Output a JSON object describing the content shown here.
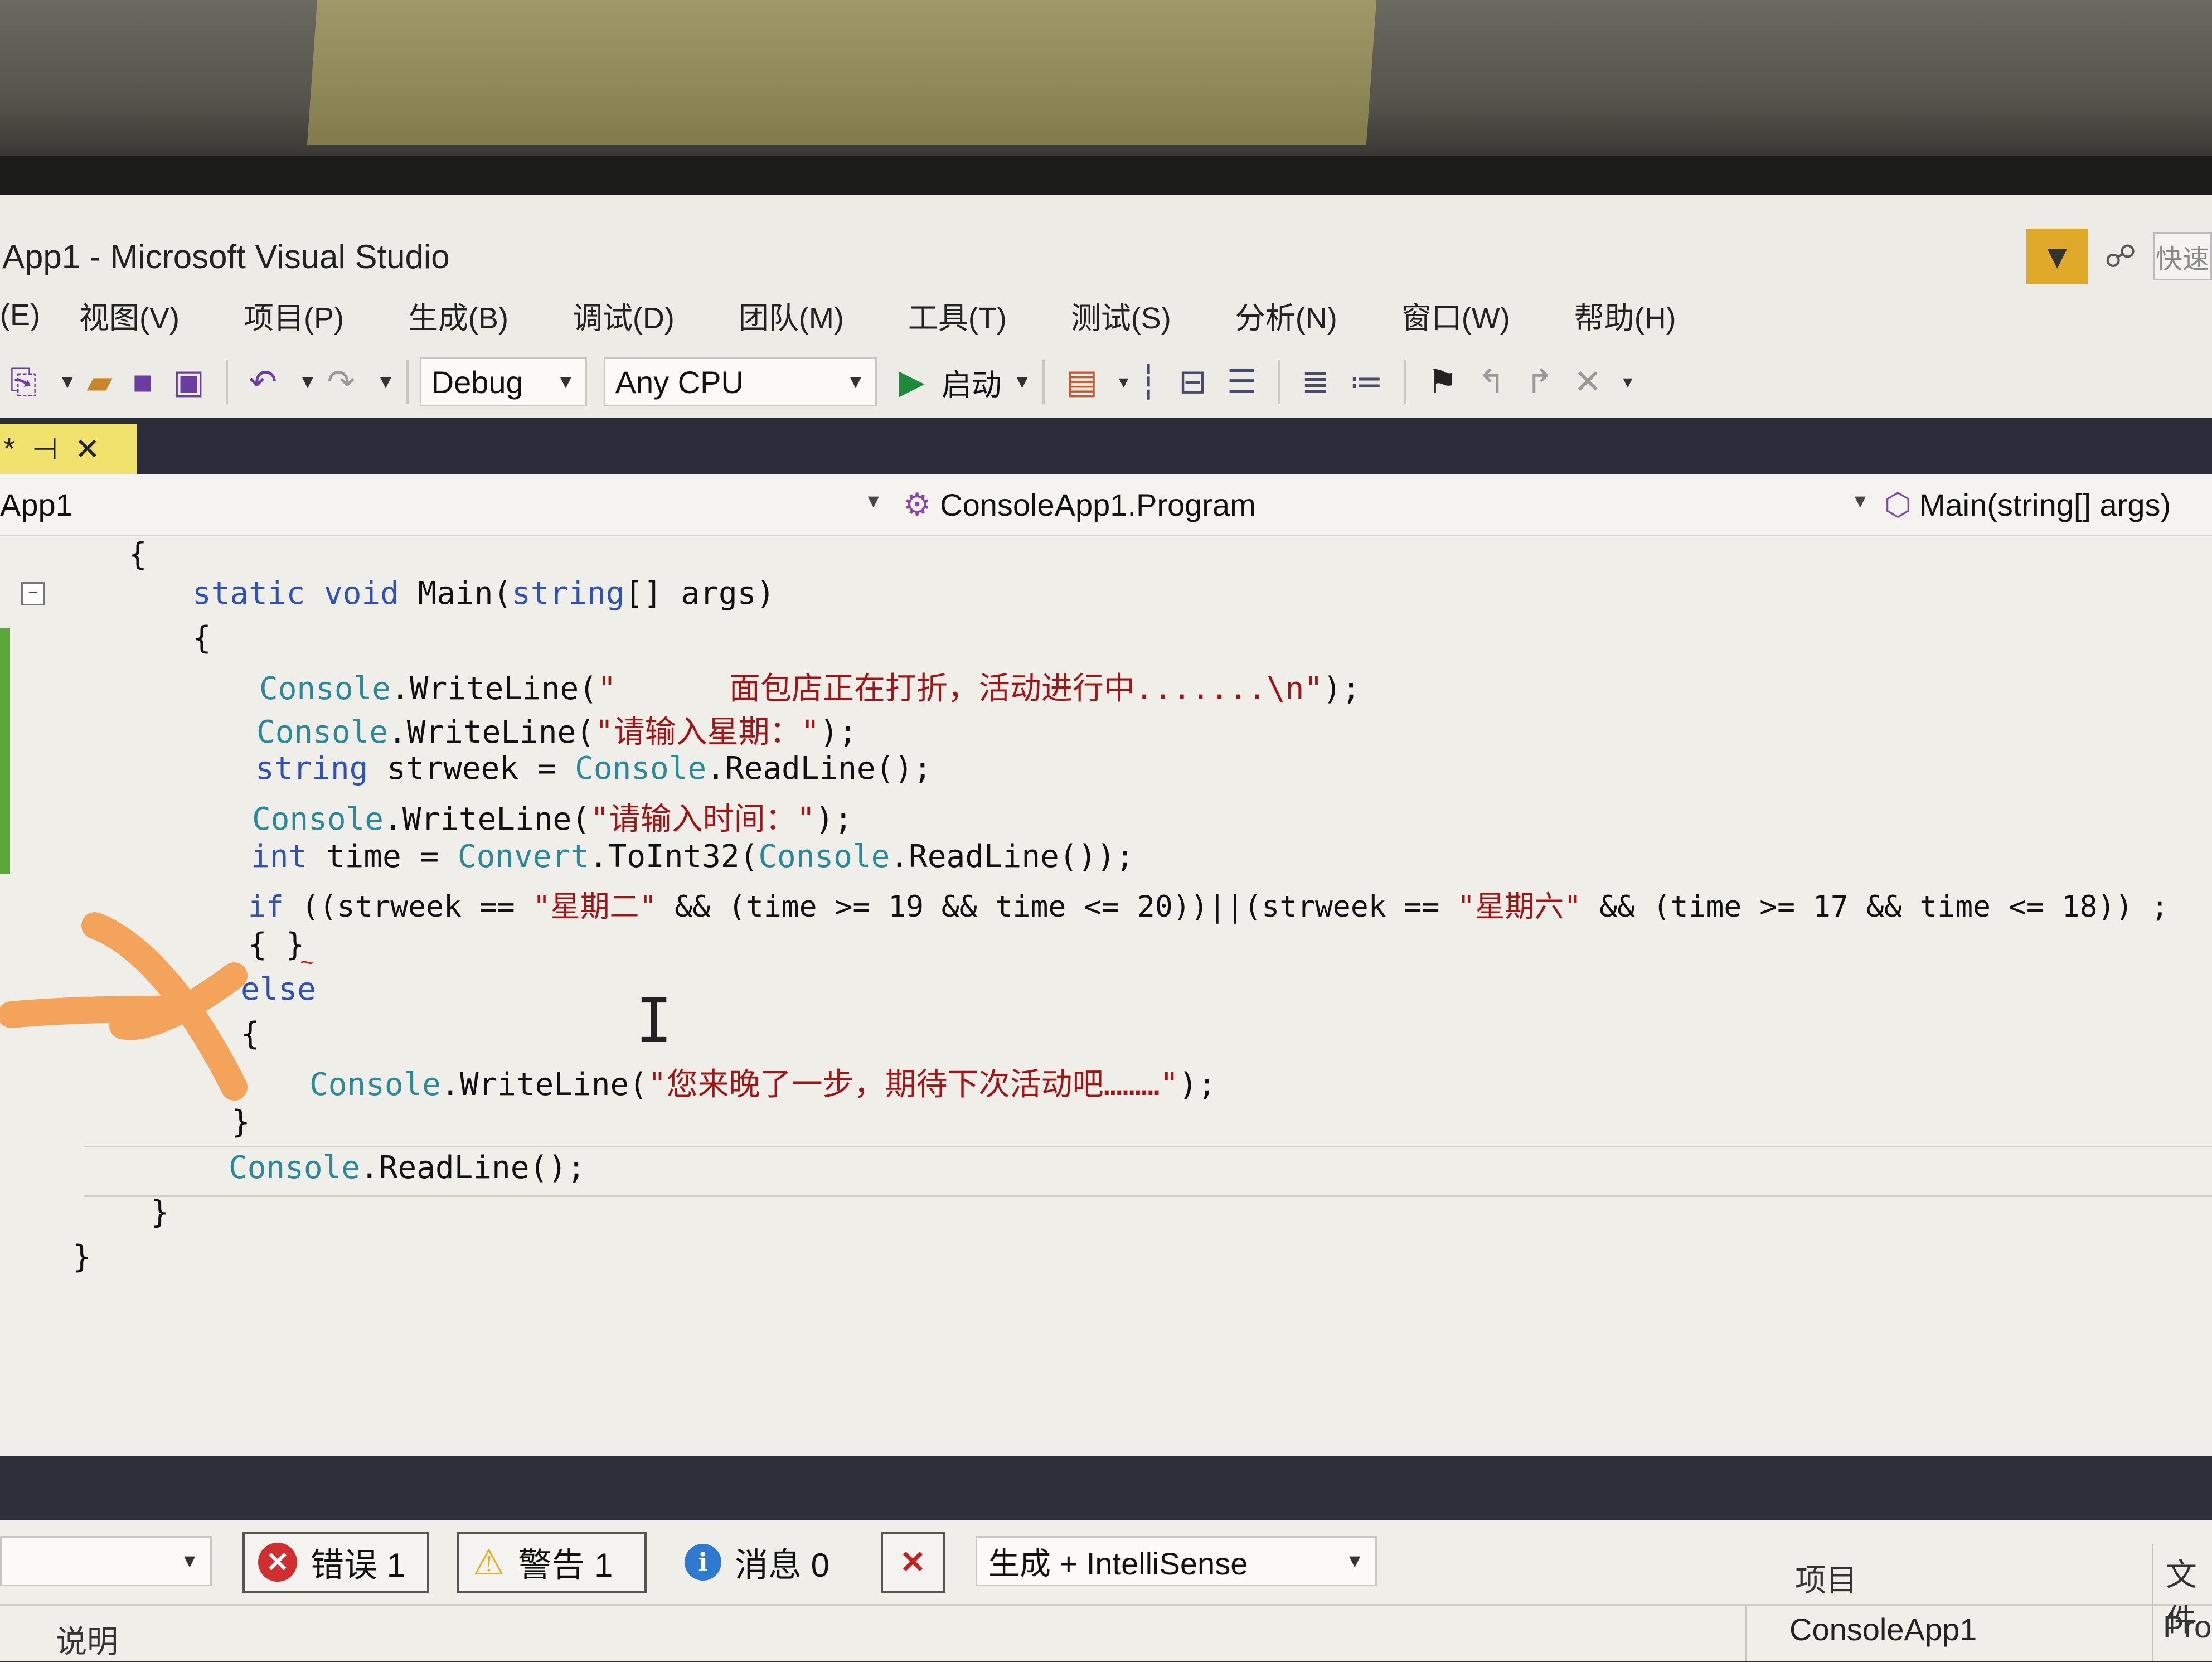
{
  "window": {
    "title": "App1 - Microsoft Visual Studio"
  },
  "menu": [
    "(E)",
    "视图(V)",
    "项目(P)",
    "生成(B)",
    "调试(D)",
    "团队(M)",
    "工具(T)",
    "测试(S)",
    "分析(N)",
    "窗口(W)",
    "帮助(H)"
  ],
  "titlebar": {
    "quick_launch": "快速"
  },
  "toolbar": {
    "config": "Debug",
    "platform": "Any CPU",
    "start_label": "启动"
  },
  "doc_tab": {
    "label": "*"
  },
  "nav": {
    "project": "App1",
    "class": "ConsoleApp1.Program",
    "member": "Main(string[] args)"
  },
  "code": {
    "l1": "{",
    "l2_kw1": "static",
    "l2_kw2": "void",
    "l2_name": "Main(",
    "l2_kw3": "string",
    "l2_rest": "[] args)",
    "l3": "{",
    "l4_ty": "Console",
    "l4_m": ".WriteLine(",
    "l4_str": "\"      面包店正在打折，活动进行中.......\\n\"",
    "l4_end": ");",
    "l5_ty": "Console",
    "l5_m": ".WriteLine(",
    "l5_str": "\"请输入星期：\"",
    "l5_end": ");",
    "l6_kw": "string",
    "l6_mid": " strweek = ",
    "l6_ty": "Console",
    "l6_end": ".ReadLine();",
    "l7_ty": "Console",
    "l7_m": ".WriteLine(",
    "l7_str": "\"请输入时间：\"",
    "l7_end": ");",
    "l8_kw": "int",
    "l8_mid": " time = ",
    "l8_ty1": "Convert",
    "l8_m": ".ToInt32(",
    "l8_ty2": "Console",
    "l8_end": ".ReadLine());",
    "l9_kw": "if",
    "l9_a": " ((strweek == ",
    "l9_s1": "\"星期二\"",
    "l9_b": " && (time >= 19 && time <= 20))||(strweek == ",
    "l9_s2": "\"星期六\"",
    "l9_c": " && (time >= 17 && time <= 18))",
    "l9_end": ";",
    "l10": "{ }",
    "l11_kw": "else",
    "l12": "{",
    "l13_ty": "Console",
    "l13_m": ".WriteLine(",
    "l13_str": "\"您来晚了一步，期待下次活动吧………\"",
    "l13_end": ");",
    "l14": "}",
    "l15_ty": "Console",
    "l15_end": ".ReadLine();",
    "l16": "}",
    "l17": "}"
  },
  "error_list": {
    "errors": "错误 1",
    "warnings": "警告 1",
    "messages": "消息 0",
    "scope": "生成 + IntelliSense"
  },
  "columns": {
    "description": "说明",
    "project": "项目",
    "file": "文件"
  },
  "row": {
    "project": "ConsoleApp1",
    "file": "Pro"
  },
  "colors": {
    "accent": "#e0a92a",
    "tab": "#f0e26c",
    "keyword": "#2f52b8",
    "type": "#2a8a9a",
    "string": "#a31515",
    "marker": "#f3a35a"
  }
}
